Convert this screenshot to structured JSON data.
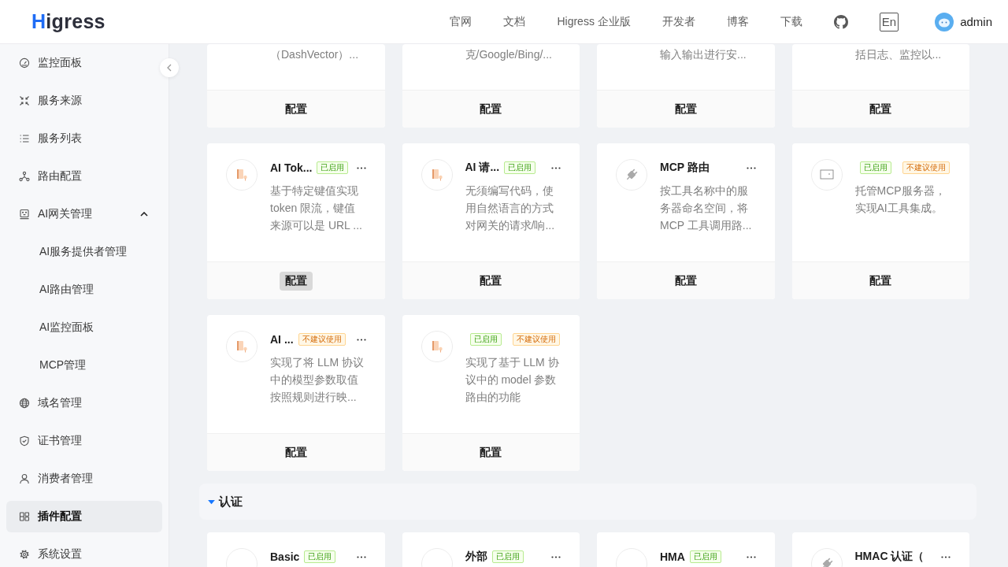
{
  "header": {
    "logo": "Higress",
    "nav": [
      "官网",
      "文档",
      "Higress 企业版",
      "开发者",
      "博客",
      "下载"
    ],
    "language": "En",
    "user": "admin"
  },
  "sidebar": {
    "items": [
      {
        "label": "监控面板",
        "selected": false
      },
      {
        "label": "服务来源",
        "selected": false
      },
      {
        "label": "服务列表",
        "selected": false
      },
      {
        "label": "路由配置",
        "selected": false
      },
      {
        "label": "AI网关管理",
        "selected": false,
        "expanded": true,
        "children": [
          {
            "label": "AI服务提供者管理",
            "selected": false
          },
          {
            "label": "AI路由管理",
            "selected": false
          },
          {
            "label": "AI监控面板",
            "selected": false
          },
          {
            "label": "MCP管理",
            "selected": false
          }
        ]
      },
      {
        "label": "域名管理",
        "selected": false
      },
      {
        "label": "证书管理",
        "selected": false
      },
      {
        "label": "消费者管理",
        "selected": false
      },
      {
        "label": "插件配置",
        "selected": true
      },
      {
        "label": "系统设置",
        "selected": false
      }
    ]
  },
  "sections": [
    {
      "cards": [
        {
          "kind": "cut",
          "description": [
            "（DashVector）..."
          ],
          "button": "配置",
          "hovered": false
        },
        {
          "kind": "cut",
          "description": [
            "克/Google/Bing/..."
          ],
          "button": "配置",
          "hovered": false
        },
        {
          "kind": "cut",
          "description": [
            "输入输出进行安..."
          ],
          "button": "配置",
          "hovered": false
        },
        {
          "kind": "cut",
          "description": [
            "括日志、监控以..."
          ],
          "button": "配置",
          "hovered": false
        },
        {
          "kind": "full",
          "title": "AI Tok...",
          "badges": [
            {
              "label": "已启用",
              "kind": "enabled"
            }
          ],
          "menu": true,
          "description": [
            "基于特定键值实现",
            "token 限流，键值",
            "来源可以是 URL ..."
          ],
          "button": "配置",
          "hovered": true
        },
        {
          "kind": "full",
          "title": "AI 请...",
          "badges": [
            {
              "label": "已启用",
              "kind": "enabled"
            }
          ],
          "menu": true,
          "description": [
            "无须编写代码，使",
            "用自然语言的方式",
            "对网关的请求/响..."
          ],
          "button": "配置",
          "hovered": false
        },
        {
          "kind": "full",
          "title": "MCP 路由",
          "menu": true,
          "description": [
            "按工具名称中的服",
            "务器命名空间，将",
            "MCP 工具调用路..."
          ],
          "button": "配置",
          "hovered": false
        },
        {
          "kind": "full",
          "badges": [
            {
              "label": "已启用",
              "kind": "enabled"
            },
            {
              "label": "不建议使用",
              "kind": "deprecated"
            }
          ],
          "menu": false,
          "description": [
            "托管MCP服务器，",
            "实现AI工具集成。"
          ],
          "button": "配置",
          "hovered": false
        },
        {
          "kind": "full",
          "title": "AI ...",
          "badges": [
            {
              "label": "不建议使用",
              "kind": "deprecated"
            }
          ],
          "menu": true,
          "description": [
            "实现了将 LLM 协议",
            "中的模型参数取值",
            "按照规则进行映..."
          ],
          "button": "配置",
          "hovered": false
        },
        {
          "kind": "full",
          "badges": [
            {
              "label": "已启用",
              "kind": "enabled"
            },
            {
              "label": "不建议使用",
              "kind": "deprecated"
            }
          ],
          "menu": false,
          "description": [
            "实现了基于 LLM 协",
            "议中的 model 参数",
            "路由的功能"
          ],
          "button": "配置",
          "hovered": false
        }
      ]
    },
    {
      "title": "认证",
      "expanded": true,
      "cards": [
        {
          "kind": "full",
          "title": "Basic",
          "badges": [
            {
              "label": "已启用",
              "kind": "enabled"
            }
          ],
          "menu": true
        },
        {
          "kind": "full",
          "title": "外部",
          "badges": [
            {
              "label": "已启用",
              "kind": "enabled"
            }
          ],
          "menu": true
        },
        {
          "kind": "full",
          "title": "HMA",
          "badges": [
            {
              "label": "已启用",
              "kind": "enabled"
            }
          ],
          "menu": true
        },
        {
          "kind": "full",
          "title": "HMAC 认证（",
          "menu": true
        }
      ]
    }
  ]
}
